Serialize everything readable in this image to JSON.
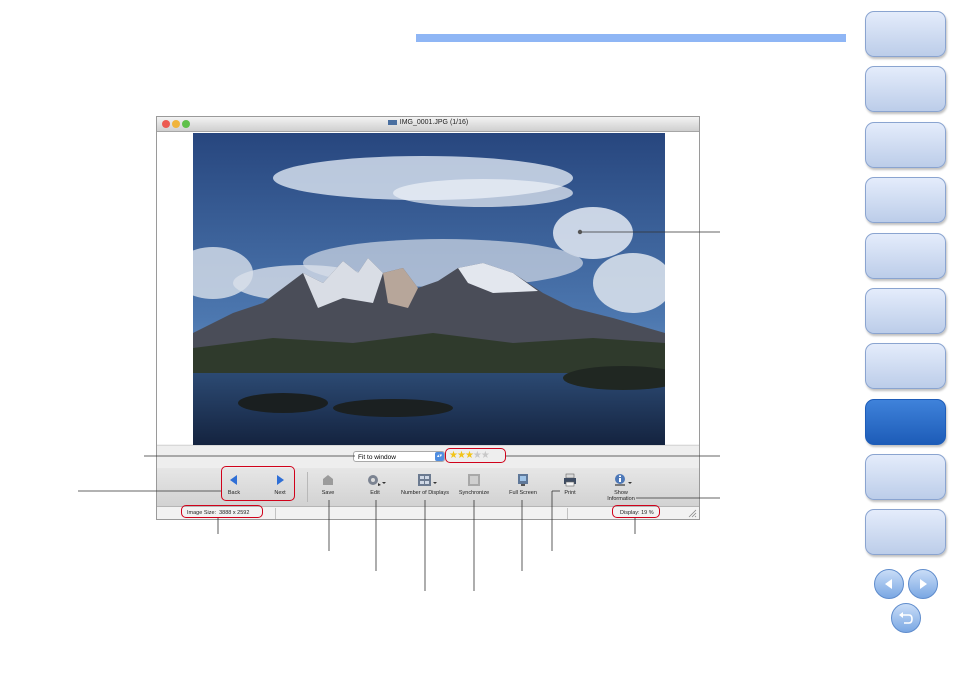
{
  "window": {
    "title": "IMG_0001.JPG (1/16)"
  },
  "viewer": {
    "fit_select_value": "Fit to window",
    "rating": 3,
    "rating_max": 5
  },
  "toolbar": {
    "back_label": "Back",
    "next_label": "Next",
    "save_label": "Save",
    "edit_label": "Edit",
    "displays_label": "Number of Displays",
    "sync_label": "Synchronize",
    "fullscreen_label": "Full Screen",
    "print_label": "Print",
    "showinfo_label_1": "Show",
    "showinfo_label_2": "Information"
  },
  "status": {
    "image_size_label": "Image Size:",
    "image_size_value": "3888 x 2592",
    "display_label": "Display:",
    "display_value": "19 %"
  },
  "colors": {
    "accent_bar": "#8fb6f5",
    "active_tab": "#1d5cb8",
    "callout_red": "#d0021b"
  }
}
